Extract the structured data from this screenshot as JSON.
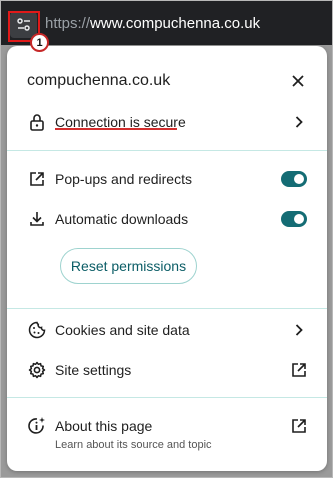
{
  "address_bar": {
    "scheme": "https://",
    "host": "www.compuchenna.co.uk",
    "site_info_icon": "tune-icon",
    "annotation_number": "1"
  },
  "panel": {
    "site_name": "compuchenna.co.uk",
    "close_icon": "close-icon",
    "connection": {
      "label": "Connection is secure",
      "icon": "lock-icon",
      "trail_icon": "chevron-right-icon"
    },
    "permissions": [
      {
        "label": "Pop-ups and redirects",
        "icon": "external-link-icon",
        "enabled": true
      },
      {
        "label": "Automatic downloads",
        "icon": "download-icon",
        "enabled": true
      }
    ],
    "reset_label": "Reset permissions",
    "cookies": {
      "label": "Cookies and site data",
      "icon": "cookie-icon",
      "trail_icon": "chevron-right-icon"
    },
    "site_settings": {
      "label": "Site settings",
      "icon": "gear-icon",
      "trail_icon": "open-in-new-icon"
    },
    "about": {
      "label": "About this page",
      "sublabel": "Learn about its source and topic",
      "icon": "info-sparkle-icon",
      "trail_icon": "open-in-new-icon"
    }
  },
  "colors": {
    "accent": "#146c74",
    "divider": "#c5e8e4",
    "annotation_red": "#e01919",
    "address_bar_bg": "#202124"
  }
}
